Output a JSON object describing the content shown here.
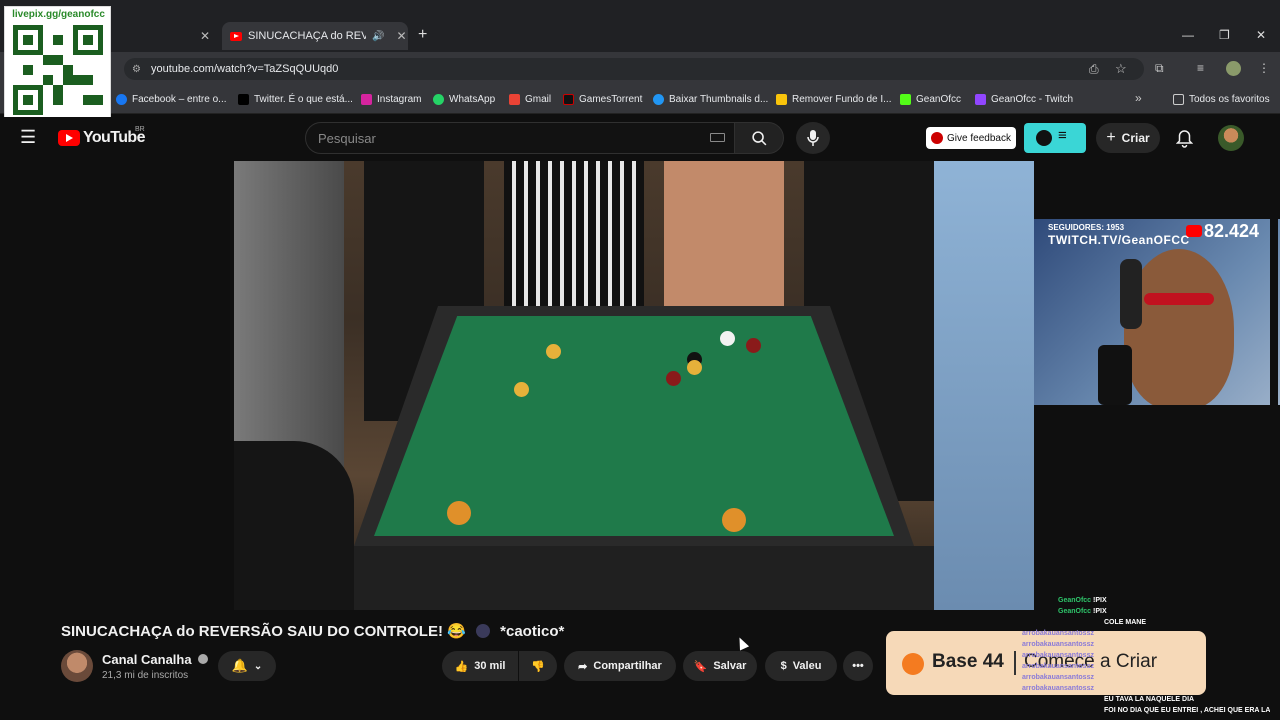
{
  "browser": {
    "tabs": [
      {
        "label": "SINUCACHAÇA do REVERS",
        "active": true
      }
    ],
    "url": "youtube.com/watch?v=TaZSqQUUqd0",
    "bookmarks": [
      {
        "label": "Facebook – entre o...",
        "color": "#1877f2"
      },
      {
        "label": "Twitter. É o que está...",
        "color": "#000000"
      },
      {
        "label": "Instagram",
        "color": "#d6249f"
      },
      {
        "label": "WhatsApp",
        "color": "#25d366"
      },
      {
        "label": "Gmail",
        "color": "#ea4335"
      },
      {
        "label": "GamesTorrent",
        "color": "#111111"
      },
      {
        "label": "Baixar Thumbnails d...",
        "color": "#2196f3"
      },
      {
        "label": "Remover Fundo de I...",
        "color": "#f9c40b"
      },
      {
        "label": "GeanOfcc",
        "color": "#53fc18"
      },
      {
        "label": "GeanOfcc - Twitch",
        "color": "#9146ff"
      }
    ],
    "all_bookmarks_label": "Todos os favoritos"
  },
  "overlay": {
    "qr_caption": "livepix.gg/geanofcc",
    "webcam_top_label": "SEGUIDORES: 1953",
    "webcam_title": "TWITCH.TV/GeanOFCC",
    "webcam_count": "82.424"
  },
  "youtube": {
    "logo_text": "YouTube",
    "region": "BR",
    "search_placeholder": "Pesquisar",
    "feedback_label": "Give feedback",
    "create_label": "Criar",
    "video_title": "SINUCACHAÇA do REVERSÃO SAIU DO CONTROLE! 😂",
    "video_tag": "*caotico*",
    "channel_name": "Canal Canalha",
    "channel_subs": "21,3 mi de inscritos",
    "likes": "30 mil",
    "share_label": "Compartilhar",
    "save_label": "Salvar",
    "thanks_label": "Valeu",
    "promo_brand": "Base 44",
    "promo_cta": "Comece a Criar"
  },
  "chat": [
    {
      "user": "GeanOfcc",
      "msg": "!PIX",
      "type": "g"
    },
    {
      "user": "GeanOfcc",
      "msg": "!PIX",
      "type": "g"
    },
    {
      "user": "",
      "msg": "COLE MANE",
      "type": "u"
    },
    {
      "user": "arrobakauansantossz",
      "msg": "",
      "type": "u"
    },
    {
      "user": "arrobakauansantossz",
      "msg": "",
      "type": "u"
    },
    {
      "user": "arrobakauansantossz",
      "msg": "",
      "type": "u"
    },
    {
      "user": "arrobakauansantossz",
      "msg": "",
      "type": "u"
    },
    {
      "user": "arrobakauansantossz",
      "msg": "",
      "type": "u"
    },
    {
      "user": "arrobakauansantossz",
      "msg": "",
      "type": "u"
    },
    {
      "user": "arrobakauansantossz",
      "msg": "",
      "type": "u"
    },
    {
      "user": "",
      "msg": "EU TAVA LA NAQUELE DIA",
      "type": "u"
    },
    {
      "user": "",
      "msg": "FOI NO DIA QUE EU ENTREI , ACHEI QUE ERA LA",
      "type": "u"
    }
  ]
}
